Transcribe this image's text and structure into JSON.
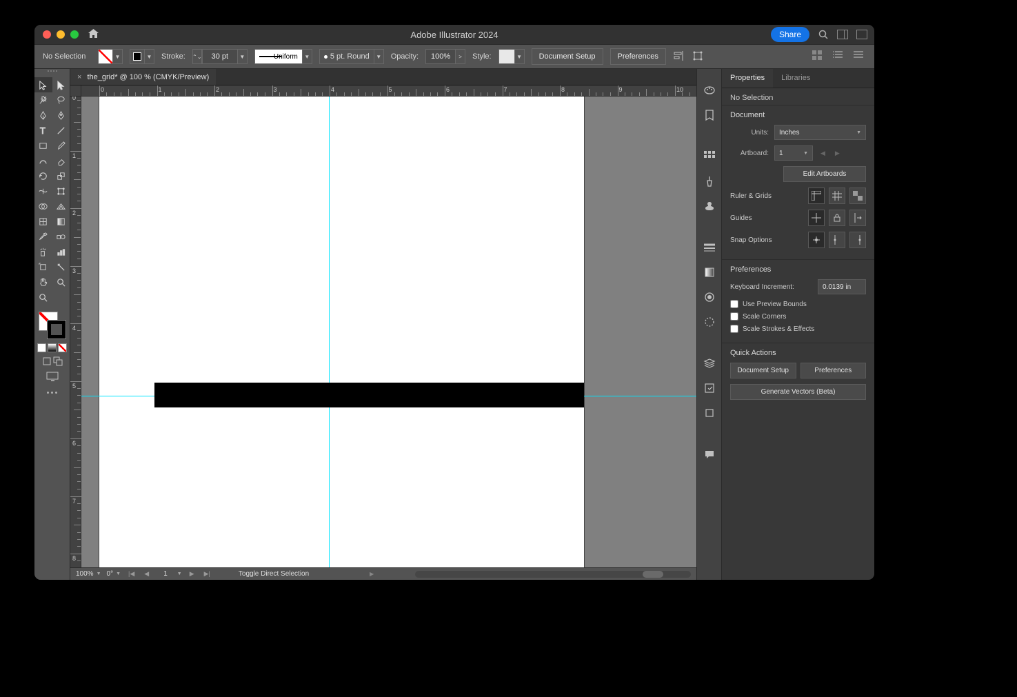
{
  "app": {
    "title": "Adobe Illustrator 2024",
    "share": "Share"
  },
  "controlbar": {
    "selection": "No Selection",
    "stroke_label": "Stroke:",
    "stroke_weight": "30 pt",
    "profile": "Uniform",
    "varwidth": "5 pt. Round",
    "opacity_label": "Opacity:",
    "opacity": "100%",
    "style_label": "Style:",
    "doc_setup": "Document Setup",
    "prefs": "Preferences"
  },
  "tab": {
    "name": "the_grid* @ 100 % (CMYK/Preview)"
  },
  "status": {
    "zoom": "100%",
    "rotate": "0°",
    "artboard": "1",
    "msg": "Toggle Direct Selection"
  },
  "ruler": {
    "h": [
      "0",
      "1",
      "2",
      "3",
      "4",
      "5",
      "6",
      "7",
      "8",
      "9",
      "10"
    ],
    "v": [
      "0",
      "1",
      "2",
      "3",
      "4",
      "5",
      "6",
      "7",
      "8"
    ]
  },
  "panels": {
    "tabs": {
      "properties": "Properties",
      "libraries": "Libraries"
    },
    "no_selection": "No Selection",
    "document": {
      "title": "Document",
      "units_label": "Units:",
      "units": "Inches",
      "artboard_label": "Artboard:",
      "artboard": "1",
      "edit_artboards": "Edit Artboards"
    },
    "ruler_grids": "Ruler & Grids",
    "guides": "Guides",
    "snap": "Snap Options",
    "prefs": {
      "title": "Preferences",
      "kb_label": "Keyboard Increment:",
      "kb": "0.0139 in",
      "preview": "Use Preview Bounds",
      "scale_corners": "Scale Corners",
      "scale_strokes": "Scale Strokes & Effects"
    },
    "quick": {
      "title": "Quick Actions",
      "doc_setup": "Document Setup",
      "prefs": "Preferences",
      "gen": "Generate Vectors (Beta)"
    }
  }
}
